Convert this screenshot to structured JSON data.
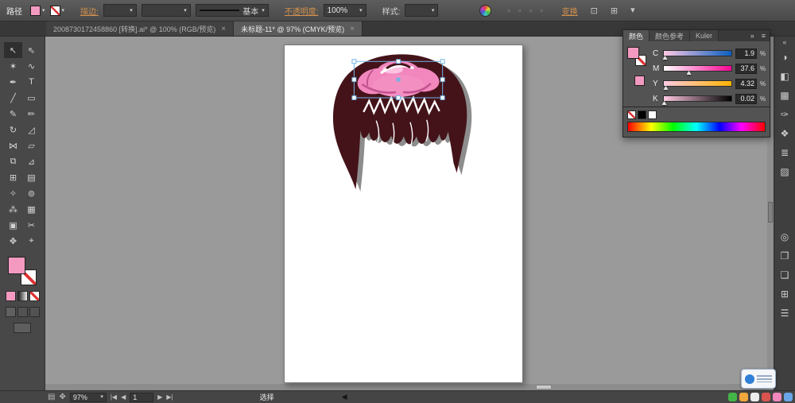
{
  "colors": {
    "fill_pink": "#f49ac1",
    "hair_maroon": "#44131a",
    "bow_pink": "#f287be",
    "bow_dark_pink": "#c2538f",
    "selection_blue": "#74b3e3",
    "link_orange": "#d4924e",
    "canvas_gray": "#9a9a9a"
  },
  "ui": {
    "caret": "▾",
    "collapse": "»",
    "double_left": "«",
    "menu": "≡",
    "align_icons": "▫ ▫ ▫ ▫",
    "isolate_icon": "⊡",
    "arrange_icon": "⊞"
  },
  "control_bar": {
    "object_label": "路径",
    "stroke_label": "描边:",
    "brush_name": "基本",
    "opacity_label": "不透明度:",
    "opacity_value": "100%",
    "style_label": "样式:",
    "transform_label": "变换"
  },
  "tabs": [
    {
      "label": "2008730172458860 [转换].ai* @ 100% (RGB/预览)",
      "close": "×",
      "active": false
    },
    {
      "label": "未标题-11* @ 97% (CMYK/预览)",
      "close": "×",
      "active": true
    }
  ],
  "tools": [
    {
      "name": "selection-tool",
      "glyph": "↖",
      "active": true
    },
    {
      "name": "direct-selection-tool",
      "glyph": "⇖"
    },
    {
      "name": "magic-wand-tool",
      "glyph": "✶"
    },
    {
      "name": "lasso-tool",
      "glyph": "∿"
    },
    {
      "name": "pen-tool",
      "glyph": "✒"
    },
    {
      "name": "type-tool",
      "glyph": "T"
    },
    {
      "name": "line-segment-tool",
      "glyph": "╱"
    },
    {
      "name": "rectangle-tool",
      "glyph": "▭"
    },
    {
      "name": "paintbrush-tool",
      "glyph": "✎"
    },
    {
      "name": "pencil-tool",
      "glyph": "✏"
    },
    {
      "name": "rotate-tool",
      "glyph": "↻"
    },
    {
      "name": "scale-tool",
      "glyph": "◿"
    },
    {
      "name": "width-tool",
      "glyph": "⋈"
    },
    {
      "name": "free-transform-tool",
      "glyph": "▱"
    },
    {
      "name": "shape-builder-tool",
      "glyph": "⧉"
    },
    {
      "name": "perspective-grid-tool",
      "glyph": "⊿"
    },
    {
      "name": "mesh-tool",
      "glyph": "⊞"
    },
    {
      "name": "gradient-tool",
      "glyph": "▤"
    },
    {
      "name": "eyedropper-tool",
      "glyph": "✧"
    },
    {
      "name": "blend-tool",
      "glyph": "⊚"
    },
    {
      "name": "symbol-sprayer-tool",
      "glyph": "⁂"
    },
    {
      "name": "column-graph-tool",
      "glyph": "▦"
    },
    {
      "name": "artboard-tool",
      "glyph": "▣"
    },
    {
      "name": "slice-tool",
      "glyph": "✂"
    },
    {
      "name": "hand-tool",
      "glyph": "✥"
    },
    {
      "name": "zoom-tool",
      "glyph": "⌖"
    }
  ],
  "color_panel": {
    "tabs": [
      {
        "label": "颜色",
        "active": true
      },
      {
        "label": "颜色参考",
        "active": false
      },
      {
        "label": "Kuler",
        "active": false
      }
    ],
    "collapse_glyph": "»",
    "menu_glyph": "≡",
    "sliders": [
      {
        "label": "C",
        "value": "1.9",
        "unit": "%",
        "pos": "2%",
        "track": "linear-gradient(to right,#ffc9e3,#0a5fc0)"
      },
      {
        "label": "M",
        "value": "37.6",
        "unit": "%",
        "pos": "38%",
        "track": "linear-gradient(to right,#ffffff,#f70493)"
      },
      {
        "label": "Y",
        "value": "4.32",
        "unit": "%",
        "pos": "4%",
        "track": "linear-gradient(to right,#ffc9e3,#ffb400)"
      },
      {
        "label": "K",
        "value": "0.02",
        "unit": "%",
        "pos": "1%",
        "track": "linear-gradient(to right,#ffc9e3,#000000)"
      }
    ]
  },
  "dock_icons_top": [
    {
      "name": "color-panel-icon",
      "glyph": "◑"
    },
    {
      "name": "color-guide-panel-icon",
      "glyph": "◧"
    },
    {
      "name": "swatches-panel-icon",
      "glyph": "▩"
    },
    {
      "name": "brushes-panel-icon",
      "glyph": "✑"
    },
    {
      "name": "symbols-panel-icon",
      "glyph": "❖"
    },
    {
      "name": "stroke-panel-icon",
      "glyph": "≣"
    },
    {
      "name": "gradient-panel-icon",
      "glyph": "▨"
    }
  ],
  "dock_icons_bottom": [
    {
      "name": "appearance-panel-icon",
      "glyph": "◎"
    },
    {
      "name": "graphic-styles-panel-icon",
      "glyph": "❐"
    },
    {
      "name": "layers-panel-icon",
      "glyph": "❏"
    },
    {
      "name": "artboards-panel-icon",
      "glyph": "⊞"
    },
    {
      "name": "align-panel-icon",
      "glyph": "☰"
    }
  ],
  "status_bar": {
    "icon1": "▤",
    "icon2": "✥",
    "zoom_value": "97%",
    "nav_first": "|◀",
    "nav_prev": "◀",
    "artboard_value": "1",
    "nav_next": "▶",
    "nav_last": "▶|",
    "tool_label": "选择",
    "marker": "◀"
  }
}
